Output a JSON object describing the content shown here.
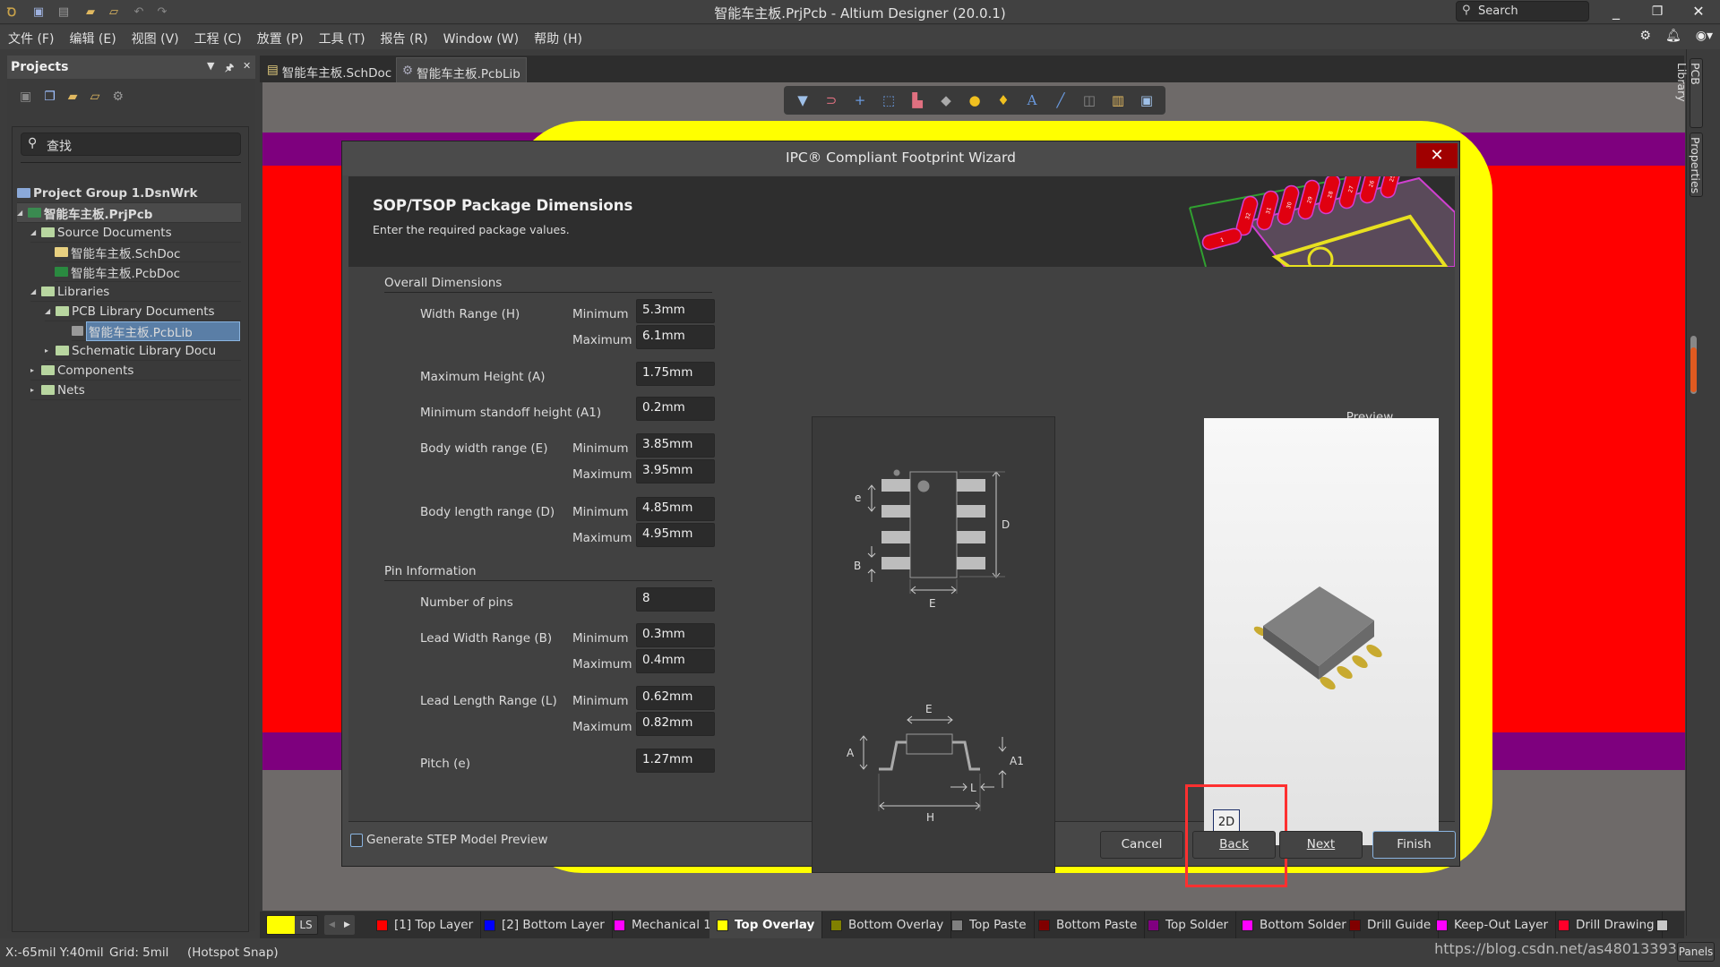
{
  "titlebar": {
    "title": "智能车主板.PrjPcb - Altium Designer (20.0.1)",
    "search_placeholder": "Search",
    "icons": [
      "altium-logo-icon",
      "save-icon",
      "save-all-icon",
      "open-icon",
      "open-project-icon",
      "undo-icon",
      "redo-icon"
    ]
  },
  "menu": {
    "items": [
      "文件 (F)",
      "编辑 (E)",
      "视图 (V)",
      "工程 (C)",
      "放置 (P)",
      "工具 (T)",
      "报告 (R)",
      "Window (W)",
      "帮助 (H)"
    ]
  },
  "projects_panel": {
    "title": "Projects",
    "search_placeholder": "查找",
    "tree": [
      {
        "label": "Project Group 1.DsnWrk",
        "level": 0,
        "bold": true
      },
      {
        "label": "智能车主板.PrjPcb",
        "level": 1,
        "bold": true,
        "expanded": true
      },
      {
        "label": "Source Documents",
        "level": 2,
        "expanded": true
      },
      {
        "label": "智能车主板.SchDoc",
        "level": 3
      },
      {
        "label": "智能车主板.PcbDoc",
        "level": 3
      },
      {
        "label": "Libraries",
        "level": 2,
        "expanded": true
      },
      {
        "label": "PCB Library Documents",
        "level": 3,
        "expanded": true
      },
      {
        "label": "智能车主板.PcbLib",
        "level": 4,
        "selected": true
      },
      {
        "label": "Schematic Library Docu",
        "level": 3,
        "expanded": false
      },
      {
        "label": "Components",
        "level": 2,
        "expanded": false
      },
      {
        "label": "Nets",
        "level": 2,
        "expanded": false
      }
    ]
  },
  "doc_tabs": [
    {
      "label": "智能车主板.SchDoc",
      "active": false
    },
    {
      "label": "智能车主板.PcbLib",
      "active": true
    }
  ],
  "dialog": {
    "title": "IPC® Compliant Footprint Wizard",
    "heading": "SOP/TSOP Package Dimensions",
    "subheading": "Enter the required package values.",
    "overall_section": "Overall Dimensions",
    "pin_section": "Pin Information",
    "min_label": "Minimum",
    "max_label": "Maximum",
    "fields": {
      "width_range_label": "Width Range (H)",
      "width_min": "5.3mm",
      "width_max": "6.1mm",
      "max_height_label": "Maximum Height (A)",
      "max_height": "1.75mm",
      "standoff_label": "Minimum standoff height (A1)",
      "standoff": "0.2mm",
      "body_width_label": "Body width range (E)",
      "body_width_min": "3.85mm",
      "body_width_max": "3.95mm",
      "body_length_label": "Body length range (D)",
      "body_length_min": "4.85mm",
      "body_length_max": "4.95mm",
      "num_pins_label": "Number of pins",
      "num_pins": "8",
      "lead_width_label": "Lead Width Range (B)",
      "lead_width_min": "0.3mm",
      "lead_width_max": "0.4mm",
      "lead_length_label": "Lead Length Range (L)",
      "lead_length_min": "0.62mm",
      "lead_length_max": "0.82mm",
      "pitch_label": "Pitch (e)",
      "pitch": "1.27mm"
    },
    "diagram_labels": {
      "e": "e",
      "B": "B",
      "D": "D",
      "E_top": "E",
      "E_side": "E",
      "A": "A",
      "A1": "A1",
      "L": "L",
      "H": "H"
    },
    "header_pads": [
      "32",
      "31",
      "30",
      "29",
      "28",
      "27",
      "26",
      "25",
      "1"
    ],
    "preview_label": "Preview",
    "btn_2d": "2D",
    "step_checkbox_label": "Generate STEP Model Preview",
    "step_checked": false,
    "buttons": {
      "cancel": "Cancel",
      "back": "Back",
      "next": "Next",
      "finish": "Finish"
    }
  },
  "layers": [
    {
      "label": "[1] Top Layer",
      "color": "#ff0000"
    },
    {
      "label": "[2] Bottom Layer",
      "color": "#0000ff"
    },
    {
      "label": "Mechanical 1",
      "color": "#ff00ff"
    },
    {
      "label": "Top Overlay",
      "color": "#ffff00",
      "active": true
    },
    {
      "label": "Bottom Overlay",
      "color": "#808000"
    },
    {
      "label": "Top Paste",
      "color": "#808080"
    },
    {
      "label": "Bottom Paste",
      "color": "#800000"
    },
    {
      "label": "Top Solder",
      "color": "#800080"
    },
    {
      "label": "Bottom Solder",
      "color": "#ff00ff"
    },
    {
      "label": "Drill Guide",
      "color": "#800000"
    },
    {
      "label": "Keep-Out Layer",
      "color": "#ff00ff"
    },
    {
      "label": "Drill Drawing",
      "color": "#ff002a"
    }
  ],
  "layer_set": {
    "label": "LS",
    "color": "#ffff00"
  },
  "right_panels": [
    "PCB Library",
    "Properties"
  ],
  "status": {
    "coords": "X:-65mil Y:40mil",
    "grid": "Grid: 5mil",
    "snap": "(Hotspot Snap)",
    "watermark": "https://blog.csdn.net/as480133937",
    "panels_label": "Panels"
  },
  "colors": {
    "canvas_red": "#ff0000",
    "canvas_purple": "#7e007e",
    "overlay_yellow": "#ffff00",
    "close_red": "#a00000",
    "highlight_red": "#ff3030",
    "selected_blue": "#5a7ea6"
  }
}
